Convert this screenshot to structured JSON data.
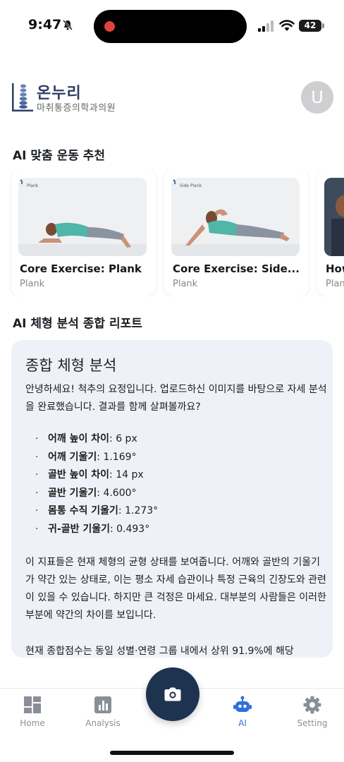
{
  "status_bar": {
    "time": "9:47",
    "battery": "42"
  },
  "header": {
    "logo_name": "온누리",
    "logo_sub": "마취통증의학과의원",
    "avatar_initial": "U"
  },
  "exercise_section": {
    "title": "AI 맞춤 운동 추천",
    "cards": [
      {
        "tag": "Plank",
        "title": "Core Exercise: Plank",
        "subtitle": "Plank"
      },
      {
        "tag": "Side Plank",
        "title": "Core Exercise: Side...",
        "subtitle": "Plank"
      },
      {
        "tag": "",
        "title": "How",
        "subtitle": "Plan"
      }
    ]
  },
  "report_section": {
    "title": "AI 체형 분석 종합 리포트",
    "card_title": "종합 체형 분석",
    "intro": "안녕하세요! 척추의 요정입니다. 업로드하신 이미지를 바탕으로 자세 분석을 완료했습니다. 결과를 함께 살펴볼까요?",
    "metrics": [
      {
        "label": "어깨 높이 차이",
        "value": ": 6 px"
      },
      {
        "label": "어깨 기울기",
        "value": ": 1.169°"
      },
      {
        "label": "골반 높이 차이",
        "value": ": 14 px"
      },
      {
        "label": "골반 기울기",
        "value": ": 4.600°"
      },
      {
        "label": "몸통 수직 기울기",
        "value": ": 1.273°"
      },
      {
        "label": "귀-골반 기울기",
        "value": ": 0.493°"
      }
    ],
    "body": "이 지표들은 현재 체형의 균형 상태를 보여줍니다. 어깨와 골반의 기울기가 약간 있는 상태로, 이는 평소 자세 습관이나 특정 근육의 긴장도와 관련이 있을 수 있습니다. 하지만 큰 걱정은 마세요. 대부분의 사람들은 이러한 부분에 약간의 차이를 보입니다.",
    "tail": "현재 종합점수는 동일 성별·연령 그룹 내에서 상위 91.9%에 해당"
  },
  "bottom_nav": {
    "items": [
      {
        "label": "Home",
        "icon": "grid-icon"
      },
      {
        "label": "Analysis",
        "icon": "bar-chart-icon"
      },
      {
        "label": "AI",
        "icon": "robot-icon"
      },
      {
        "label": "Setting",
        "icon": "gear-icon"
      }
    ],
    "camera_icon": "camera-icon",
    "active": "AI",
    "active_color": "#2f6fdc",
    "fab_color": "#1e3350"
  }
}
